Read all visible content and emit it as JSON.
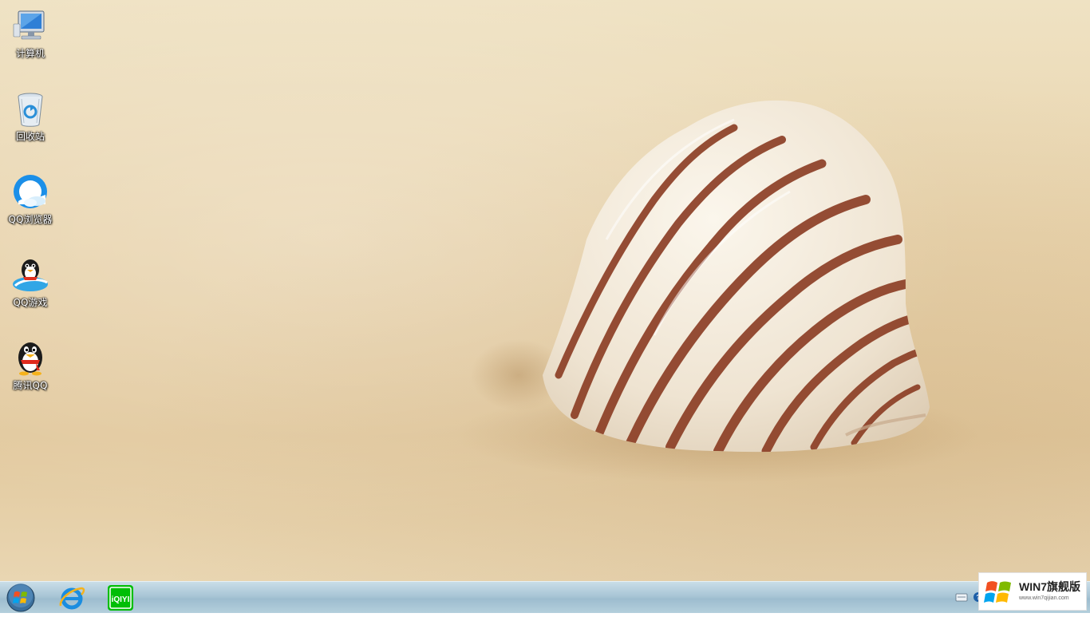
{
  "desktop": {
    "icons": [
      {
        "name": "computer-icon",
        "label": "计算机"
      },
      {
        "name": "recycle-bin-icon",
        "label": "回收站"
      },
      {
        "name": "qq-browser-icon",
        "label": "QQ浏览器"
      },
      {
        "name": "qq-game-icon",
        "label": "QQ游戏"
      },
      {
        "name": "tencent-qq-icon",
        "label": "腾讯QQ"
      }
    ]
  },
  "taskbar": {
    "pinned": [
      {
        "name": "internet-explorer-icon"
      },
      {
        "name": "iqiyi-icon",
        "text": "iQIYI"
      }
    ],
    "tray_icons": [
      "keyboard-icon",
      "help-icon"
    ]
  },
  "watermark": {
    "title": "WIN7旗舰版",
    "url": "www.win7qijian.com"
  },
  "colors": {
    "sand": "#e8d3ac",
    "shell_stripe": "#8a3b22",
    "taskbar": "#a9c6d6"
  }
}
